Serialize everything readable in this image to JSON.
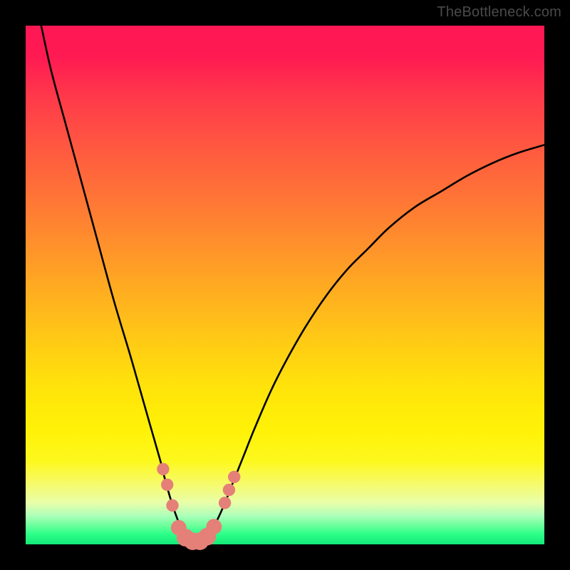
{
  "watermark": "TheBottleneck.com",
  "chart_data": {
    "type": "line",
    "title": "",
    "xlabel": "",
    "ylabel": "",
    "xlim": [
      0,
      100
    ],
    "ylim": [
      0,
      100
    ],
    "grid": false,
    "series": [
      {
        "name": "curve",
        "color": "#000000",
        "x": [
          3,
          5,
          8,
          11,
          14,
          17,
          20,
          22,
          24,
          26,
          27,
          28.5,
          30,
          31,
          32,
          33,
          34,
          36,
          38,
          40,
          42,
          44,
          47,
          50,
          54,
          58,
          62,
          66,
          70,
          75,
          80,
          85,
          90,
          95,
          100
        ],
        "y": [
          100,
          91,
          80,
          69,
          58,
          47,
          37,
          30,
          23,
          16,
          12,
          7,
          3,
          1,
          0.5,
          0.5,
          1,
          3,
          7,
          12,
          17,
          22,
          29,
          35,
          42,
          48,
          53,
          57,
          61,
          65,
          68,
          71,
          73.5,
          75.5,
          77
        ]
      }
    ],
    "markers": {
      "color": "#e58078",
      "points": [
        {
          "x": 26.5,
          "y": 14.5,
          "r": 1.2
        },
        {
          "x": 27.3,
          "y": 11.5,
          "r": 1.2
        },
        {
          "x": 28.3,
          "y": 7.5,
          "r": 1.2
        },
        {
          "x": 29.5,
          "y": 3.2,
          "r": 1.5
        },
        {
          "x": 30.8,
          "y": 1.3,
          "r": 1.7
        },
        {
          "x": 32.2,
          "y": 0.6,
          "r": 1.7
        },
        {
          "x": 33.6,
          "y": 0.6,
          "r": 1.7
        },
        {
          "x": 35.0,
          "y": 1.5,
          "r": 1.7
        },
        {
          "x": 36.3,
          "y": 3.4,
          "r": 1.5
        },
        {
          "x": 38.4,
          "y": 8.0,
          "r": 1.2
        },
        {
          "x": 39.2,
          "y": 10.5,
          "r": 1.2
        },
        {
          "x": 40.2,
          "y": 13.0,
          "r": 1.2
        }
      ]
    }
  }
}
